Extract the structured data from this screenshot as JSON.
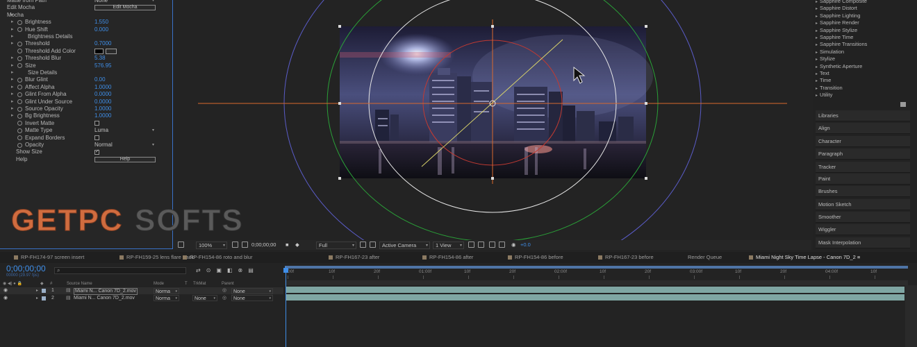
{
  "effect_controls": {
    "rows": [
      {
        "twirl": "",
        "stopwatch": false,
        "label": "Matte from Path",
        "indent": 10,
        "type": "select",
        "value": "None"
      },
      {
        "twirl": "",
        "stopwatch": false,
        "label": "Edit Mocha",
        "indent": 10,
        "type": "button",
        "value": "Edit Mocha"
      },
      {
        "twirl": "▸",
        "stopwatch": false,
        "label": "Mocha",
        "indent": 10,
        "type": "none",
        "value": ""
      },
      {
        "twirl": "▸",
        "stopwatch": true,
        "label": "Brightness",
        "indent": 36,
        "type": "value",
        "value": "1.550"
      },
      {
        "twirl": "▸",
        "stopwatch": true,
        "label": "Hue Shift",
        "indent": 36,
        "type": "value",
        "value": "0.000"
      },
      {
        "twirl": "▸",
        "stopwatch": false,
        "label": "Brightness Details",
        "indent": 40,
        "type": "none",
        "value": ""
      },
      {
        "twirl": "▸",
        "stopwatch": true,
        "label": "Threshold",
        "indent": 36,
        "type": "value",
        "value": "0.7000"
      },
      {
        "twirl": "",
        "stopwatch": true,
        "label": "Threshold Add Color",
        "indent": 36,
        "type": "color",
        "value": ""
      },
      {
        "twirl": "▸",
        "stopwatch": true,
        "label": "Threshold Blur",
        "indent": 36,
        "type": "value",
        "value": "5.38"
      },
      {
        "twirl": "▸",
        "stopwatch": true,
        "label": "Size",
        "indent": 36,
        "type": "value",
        "value": "576.95"
      },
      {
        "twirl": "▸",
        "stopwatch": false,
        "label": "Size Details",
        "indent": 40,
        "type": "none",
        "value": ""
      },
      {
        "twirl": "▸",
        "stopwatch": true,
        "label": "Blur Glint",
        "indent": 36,
        "type": "value",
        "value": "0.00"
      },
      {
        "twirl": "▸",
        "stopwatch": true,
        "label": "Affect Alpha",
        "indent": 36,
        "type": "value",
        "value": "1.0000"
      },
      {
        "twirl": "▸",
        "stopwatch": true,
        "label": "Glint From Alpha",
        "indent": 36,
        "type": "value",
        "value": "0.0000"
      },
      {
        "twirl": "▸",
        "stopwatch": true,
        "label": "Glint Under Source",
        "indent": 36,
        "type": "value",
        "value": "0.0000"
      },
      {
        "twirl": "▸",
        "stopwatch": true,
        "label": "Source Opacity",
        "indent": 36,
        "type": "value",
        "value": "1.0000"
      },
      {
        "twirl": "▸",
        "stopwatch": true,
        "label": "Bg Brightness",
        "indent": 36,
        "type": "value",
        "value": "1.0000"
      },
      {
        "twirl": "",
        "stopwatch": true,
        "label": "Invert Matte",
        "indent": 36,
        "type": "check",
        "value": "off"
      },
      {
        "twirl": "",
        "stopwatch": true,
        "label": "Matte Type",
        "indent": 36,
        "type": "select",
        "value": "Luma"
      },
      {
        "twirl": "",
        "stopwatch": true,
        "label": "Expand Borders",
        "indent": 36,
        "type": "check",
        "value": "off"
      },
      {
        "twirl": "",
        "stopwatch": true,
        "label": "Opacity",
        "indent": 36,
        "type": "select",
        "value": "Normal"
      },
      {
        "twirl": "",
        "stopwatch": false,
        "label": "Show Size",
        "indent": 23,
        "type": "check",
        "value": "on"
      },
      {
        "twirl": "",
        "stopwatch": false,
        "label": "Help",
        "indent": 23,
        "type": "button",
        "value": "Help"
      }
    ]
  },
  "watermark": "GETPCSOFTS",
  "viewer_bar": {
    "zoom": "100%",
    "timecode": "0;00;00;00",
    "resolution": "Full",
    "camera": "Active Camera",
    "views": "1 View",
    "exposure": "+0.0"
  },
  "effects_list": [
    "Sapphire Composite",
    "Sapphire Distort",
    "Sapphire Lighting",
    "Sapphire Render",
    "Sapphire Stylize",
    "Sapphire Time",
    "Sapphire Transitions",
    "Simulation",
    "Stylize",
    "Synthetic Aperture",
    "Text",
    "Time",
    "Transition",
    "Utility"
  ],
  "panels": [
    "Libraries",
    "Align",
    "Character",
    "Paragraph",
    "Tracker",
    "Paint",
    "Brushes",
    "Motion Sketch",
    "Smoother",
    "Wiggler",
    "Mask Interpolation"
  ],
  "timeline_tabs": [
    "RP-FH174-97 screen insert",
    "RP-FH159-25 lens flare track",
    "RP-FH154-86 roto and blur",
    "RP-FH167-23 after",
    "RP-FH154-86 after",
    "RP-FH154-86 before",
    "RP-FH167-23 before",
    "Render Queue",
    "Miami Night Sky Time Lapse - Canon 7D_2"
  ],
  "timeline": {
    "timecode": "0;00;00;00",
    "fps": "00000 (29.97 fps)",
    "search_placeholder": "",
    "headers": {
      "source": "Source Name",
      "mode": "Mode",
      "t": "T",
      "trkmat": "TrkMat",
      "parent": "Parent"
    },
    "layers": [
      {
        "num": "1",
        "name": "Miami N... Canon 7D_2.mov",
        "mode": "Norma",
        "trkmat": "",
        "parent": "None"
      },
      {
        "num": "2",
        "name": "Miami N... Canon 7D_2.mov",
        "mode": "Norma",
        "trkmat": "None",
        "parent": "None"
      }
    ],
    "ruler": [
      "00f",
      "10f",
      "20f",
      "01:00f",
      "10f",
      "20f",
      "02:00f",
      "10f",
      "20f",
      "03:00f",
      "10f",
      "20f",
      "04:00f",
      "10f"
    ]
  },
  "colors": {
    "accent": "#3f8ee8",
    "layer_bar": "#7fa6a3",
    "watermark": "#d06c3f"
  }
}
